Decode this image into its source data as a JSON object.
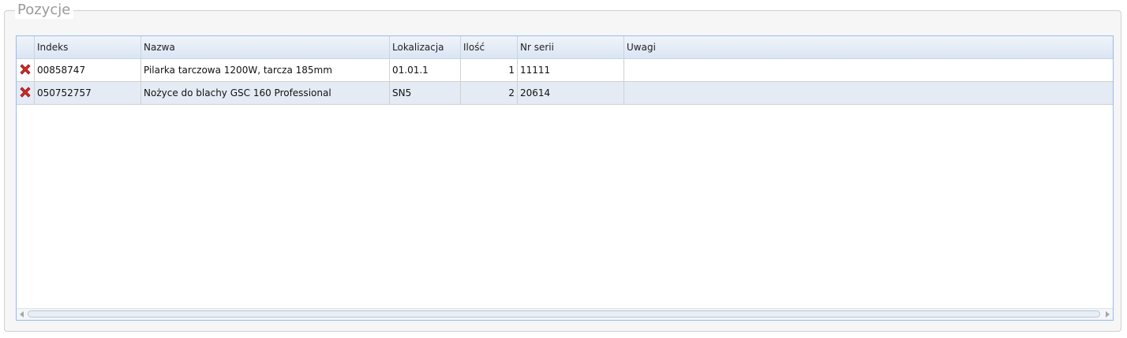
{
  "panel": {
    "title": "Pozycje"
  },
  "grid": {
    "columns": [
      {
        "key": "action",
        "label": ""
      },
      {
        "key": "indeks",
        "label": "Indeks"
      },
      {
        "key": "nazwa",
        "label": "Nazwa"
      },
      {
        "key": "lokalizacja",
        "label": "Lokalizacja"
      },
      {
        "key": "ilosc",
        "label": "Ilość"
      },
      {
        "key": "nr_serii",
        "label": "Nr serii"
      },
      {
        "key": "uwagi",
        "label": "Uwagi"
      }
    ],
    "rows": [
      {
        "delete_icon": "delete-icon",
        "indeks": "00858747",
        "nazwa": "Pilarka tarczowa 1200W, tarcza 185mm",
        "lokalizacja": "01.01.1",
        "ilosc": "1",
        "nr_serii": "11111",
        "uwagi": ""
      },
      {
        "delete_icon": "delete-icon",
        "indeks": "050752757",
        "nazwa": "Nożyce do blachy GSC 160 Professional",
        "lokalizacja": "SN5",
        "ilosc": "2",
        "nr_serii": "20614",
        "uwagi": ""
      }
    ]
  },
  "colors": {
    "header_bg": "#dae5f3",
    "alt_row_bg": "#e4ebf5",
    "grid_border": "#99bbe8",
    "delete_red": "#d42a2a"
  }
}
